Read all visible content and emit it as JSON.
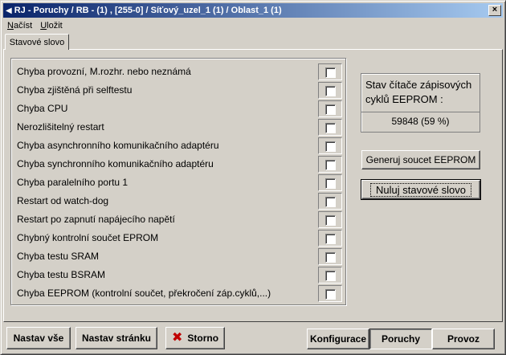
{
  "window": {
    "title": "RJ - Poruchy / RB - (1) , [255-0] / Síťový_uzel_1 (1) / Oblast_1 (1)",
    "close_glyph": "×"
  },
  "menu": {
    "items": [
      {
        "label": "Načíst",
        "underline": "N",
        "rest": "ačíst"
      },
      {
        "label": "Uložit",
        "underline": "U",
        "rest": "ložit"
      }
    ]
  },
  "tab": {
    "label": "Stavové slovo"
  },
  "errors": [
    {
      "label": "Chyba provozní, M.rozhr. nebo neznámá",
      "checked": false
    },
    {
      "label": "Chyba zjištěná při selftestu",
      "checked": false
    },
    {
      "label": "Chyba CPU",
      "checked": false
    },
    {
      "label": "Nerozlišitelný restart",
      "checked": false
    },
    {
      "label": "Chyba asynchronního komunikačního adaptéru",
      "checked": false
    },
    {
      "label": "Chyba synchronního komunikačního adaptéru",
      "checked": false
    },
    {
      "label": "Chyba paralelního portu 1",
      "checked": false
    },
    {
      "label": "Restart od watch-dog",
      "checked": false
    },
    {
      "label": "Restart po zapnutí napájecího napětí",
      "checked": false
    },
    {
      "label": "Chybný kontrolní součet EPROM",
      "checked": false
    },
    {
      "label": "Chyba testu SRAM",
      "checked": false
    },
    {
      "label": "Chyba testu BSRAM",
      "checked": false
    },
    {
      "label": "Chyba EEPROM (kontrolní součet, překročení záp.cyklů,...)",
      "checked": false
    }
  ],
  "counter": {
    "label": "Stav čítače zápisových cyklů EEPROM :",
    "value": "59848 (59 %)"
  },
  "actions": {
    "generate_label": "Generuj soucet EEPROM",
    "reset_label": "Nuluj stavové slovo"
  },
  "footer": {
    "set_all": "Nastav vše",
    "set_page": "Nastav stránku",
    "cancel": "Storno",
    "tabs": [
      {
        "label": "Konfigurace",
        "active": false
      },
      {
        "label": "Poruchy",
        "active": true
      },
      {
        "label": "Provoz",
        "active": false
      }
    ]
  }
}
